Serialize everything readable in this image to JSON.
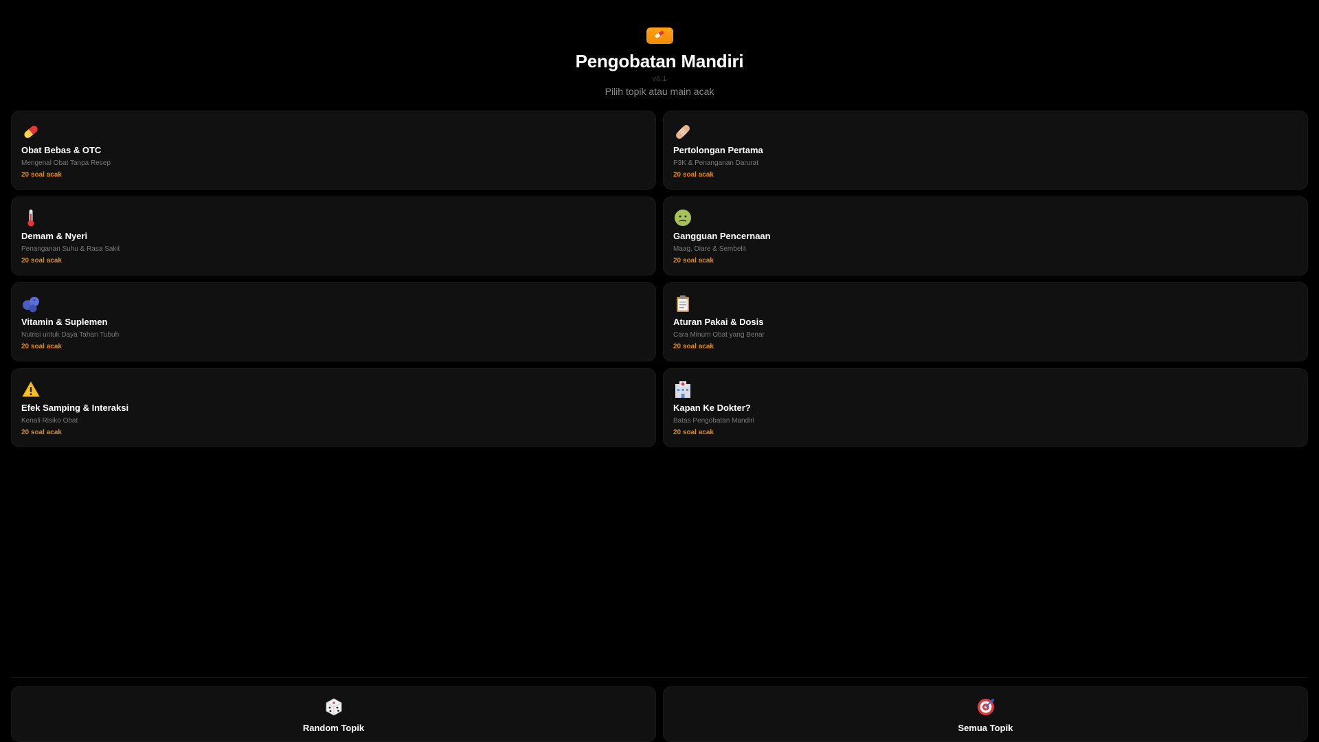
{
  "header": {
    "icon": "pill-icon",
    "title": "Pengobatan Mandiri",
    "version": "v6.1",
    "subtitle": "Pilih topik atau main acak",
    "accent": "#f59a0c"
  },
  "topics": [
    {
      "icon": "pill-icon",
      "title": "Obat Bebas & OTC",
      "subtitle": "Mengenal Obat Tanpa Resep",
      "count": "20 soal acak"
    },
    {
      "icon": "bandage-icon",
      "title": "Pertolongan Pertama",
      "subtitle": "P3K & Penanganan Darurat",
      "count": "20 soal acak"
    },
    {
      "icon": "thermometer-icon",
      "title": "Demam & Nyeri",
      "subtitle": "Penanganan Suhu & Rasa Sakit",
      "count": "20 soal acak"
    },
    {
      "icon": "nauseated-face-icon",
      "title": "Gangguan Pencernaan",
      "subtitle": "Maag, Diare & Sembelit",
      "count": "20 soal acak"
    },
    {
      "icon": "blueberries-icon",
      "title": "Vitamin & Suplemen",
      "subtitle": "Nutrisi untuk Daya Tahan Tubuh",
      "count": "20 soal acak"
    },
    {
      "icon": "clipboard-icon",
      "title": "Aturan Pakai & Dosis",
      "subtitle": "Cara Minum Obat yang Benar",
      "count": "20 soal acak"
    },
    {
      "icon": "warning-icon",
      "title": "Efek Samping & Interaksi",
      "subtitle": "Kenali Risiko Obat",
      "count": "20 soal acak"
    },
    {
      "icon": "hospital-icon",
      "title": "Kapan Ke Dokter?",
      "subtitle": "Batas Pengobatan Mandiri",
      "count": "20 soal acak"
    }
  ],
  "actions": [
    {
      "icon": "dice-icon",
      "label": "Random Topik"
    },
    {
      "icon": "target-icon",
      "label": "Semua Topik"
    }
  ],
  "colors": {
    "background": "#000000",
    "card": "#111111",
    "count_text": "#e08a14",
    "muted_text": "#7a7a7a"
  }
}
